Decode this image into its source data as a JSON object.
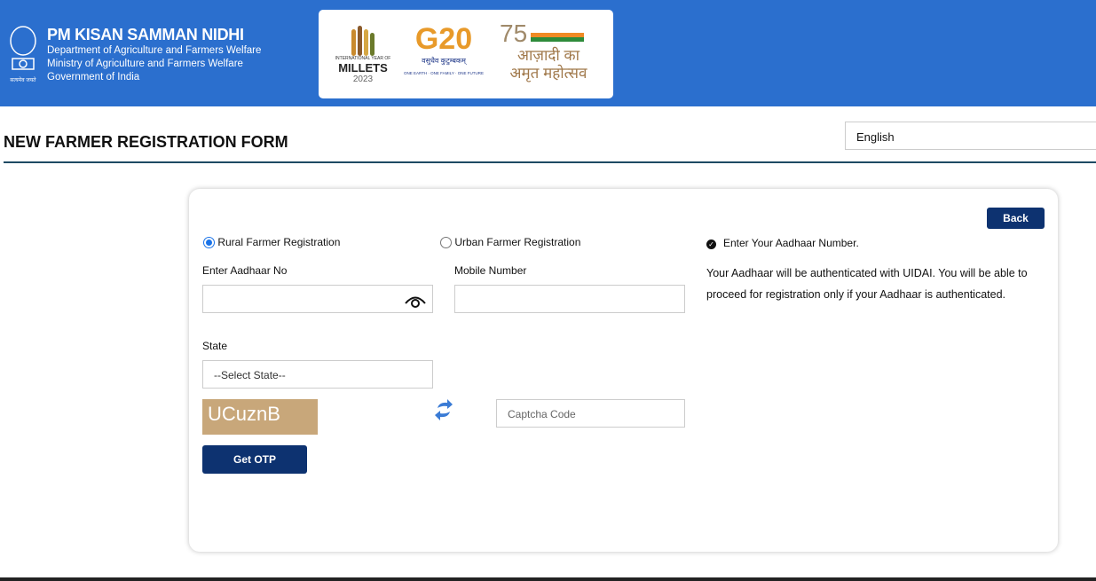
{
  "header": {
    "title": "PM KISAN SAMMAN NIDHI",
    "lines": [
      "Department of Agriculture and Farmers Welfare",
      "Ministry of Agriculture and Farmers Welfare",
      "Government of India"
    ],
    "emblem_motto": "सत्यमेव जयते",
    "logos": {
      "millets_top": "INTERNATIONAL YEAR OF",
      "millets": "MILLETS",
      "millets_year": "2023",
      "g20": "G20",
      "g20_hindi": "वसुधैव कुटुम्बकम्",
      "g20_tag": "ONE EARTH · ONE FAMILY · ONE FUTURE",
      "azadi_1": "आज़ादी का",
      "azadi_2": "अमृत महोत्सव",
      "azadi_num": "75"
    }
  },
  "page": {
    "title": "NEW FARMER REGISTRATION FORM",
    "language": "English"
  },
  "form": {
    "back": "Back",
    "rural": "Rural Farmer Registration",
    "urban": "Urban Farmer Registration",
    "rural_selected": true,
    "aadhaar_label": "Enter Aadhaar No",
    "aadhaar_value": "",
    "mobile_label": "Mobile Number",
    "mobile_value": "",
    "state_label": "State",
    "state_value": "--Select State--",
    "captcha": "UCuznB",
    "captcha_placeholder": "Captcha Code",
    "get_otp": "Get OTP"
  },
  "info": {
    "heading": "Enter Your Aadhaar Number.",
    "text": "Your Aadhaar will be authenticated with UIDAI. You will be able to proceed for registration only if your Aadhaar is authenticated."
  },
  "colors": {
    "header": "#2b6fce",
    "button": "#0d3270",
    "radio": "#1a73e8",
    "captcha_bg": "#c8a77a"
  }
}
